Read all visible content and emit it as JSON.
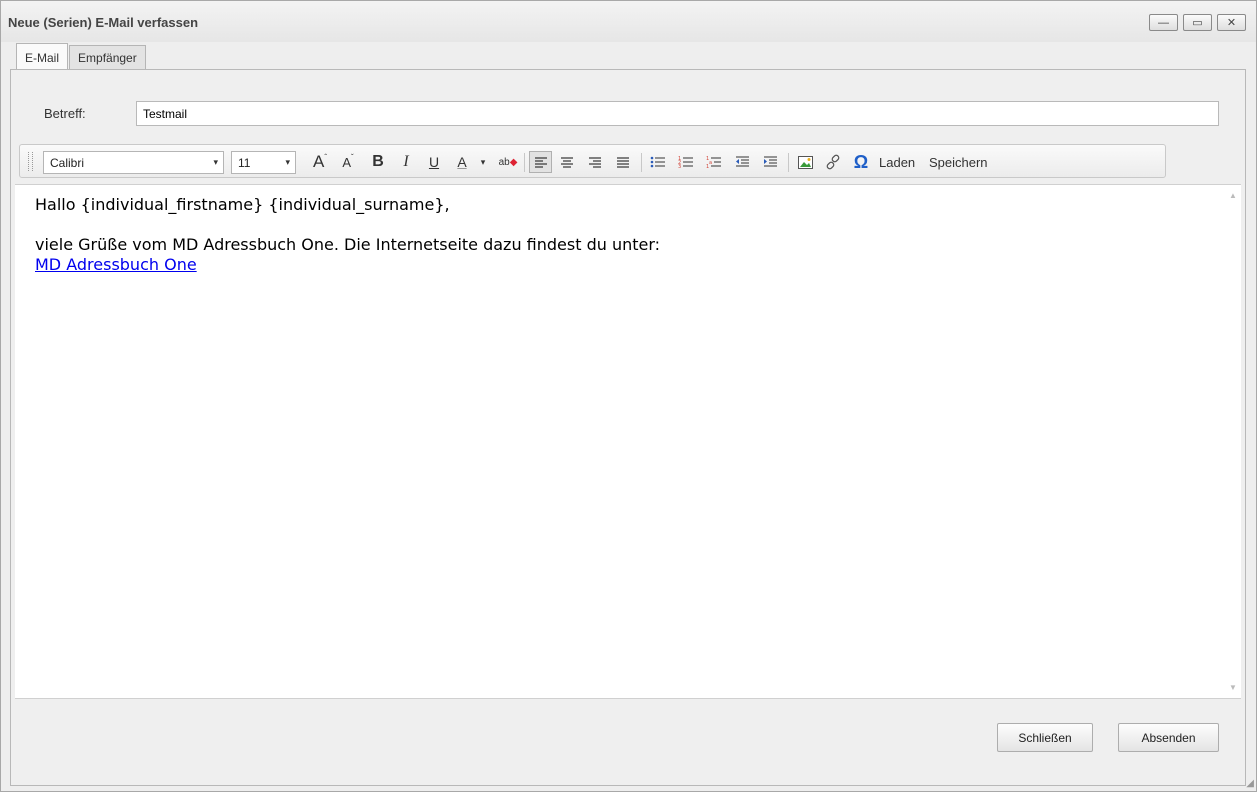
{
  "window": {
    "title": "Neue (Serien) E-Mail verfassen",
    "minimize_glyph": "—",
    "maximize_glyph": "▭",
    "close_glyph": "✕"
  },
  "tabs": [
    {
      "label": "E-Mail"
    },
    {
      "label": "Empfänger"
    }
  ],
  "subject": {
    "label": "Betreff:",
    "value": "Testmail"
  },
  "toolbar": {
    "font_name": "Calibri",
    "font_size": "11",
    "grow_font": "A",
    "shrink_font": "A",
    "bold": "B",
    "italic": "I",
    "underline": "U",
    "font_color": "A",
    "dropdown_arrow": "▾",
    "highlight": "ab",
    "omega": "Ω",
    "load_label": "Laden",
    "save_label": "Speichern"
  },
  "editor": {
    "line1": "Hallo {individual_firstname} {individual_surname},",
    "line2": "viele Grüße vom MD Adressbuch One. Die Internetseite dazu findest du unter:",
    "link_text": "MD Adressbuch One"
  },
  "buttons": {
    "close_label": "Schließen",
    "send_label": "Absenden"
  },
  "colors": {
    "link": "#0000ee",
    "align_active": "#e2e2e2"
  }
}
